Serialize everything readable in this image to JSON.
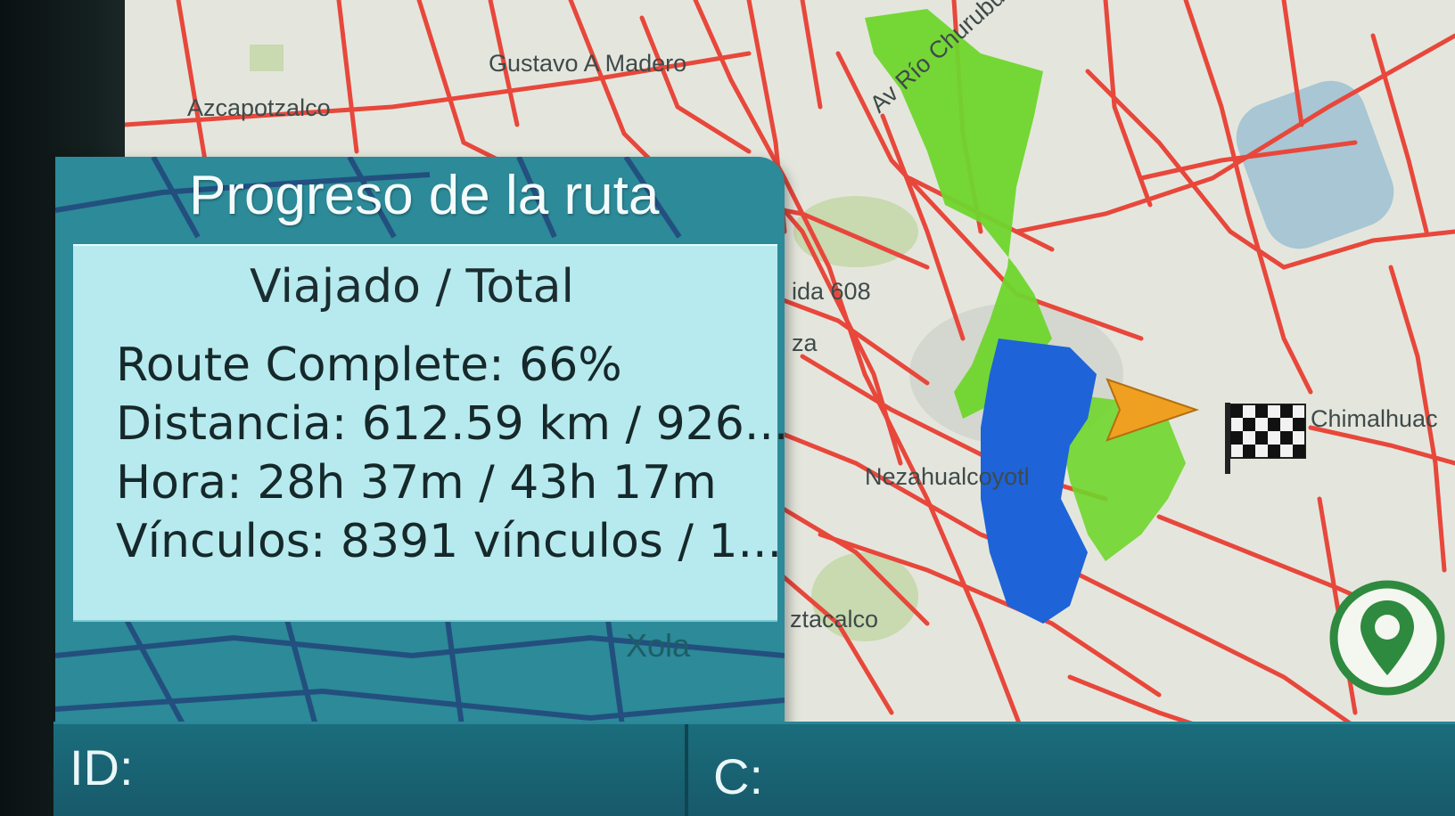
{
  "map": {
    "labels": {
      "azcapotzalco": "Azcapotzalco",
      "gustavo_madero": "Gustavo A Madero",
      "rio_churubusco": "Av Río Churubusco",
      "avenida_608": "ida 608",
      "za": "za",
      "nezahualcoyotl": "Nezahualcoyotl",
      "chimalhuacan": "Chimalhuac",
      "iztacalco": "ztacalco",
      "xola": "Xola"
    },
    "colors": {
      "background": "#e4e6dd",
      "roads": "#e8473b",
      "traveled_route": "#6fd62c",
      "pending_route": "#1e63d8",
      "park": "#c9d9b0",
      "water": "#a8c6d3",
      "vehicle_marker": "#f0a020"
    },
    "icons": {
      "vehicle": "vehicle-arrow-icon",
      "destination": "finish-flag-icon",
      "location_button": "location-pin-icon"
    }
  },
  "panel": {
    "title": "Progreso de la ruta",
    "subtitle": "Viajado / Total",
    "route_complete": "Route Complete: 66%",
    "route_complete_value": 66,
    "distance": "Distancia: 612.59 km / 926...",
    "time": "Hora: 28h 37m / 43h 17m",
    "links": "Vínculos: 8391 vínculos / 1...",
    "colors": {
      "header": "#2c8a99",
      "body": "#b6eaee"
    }
  },
  "statusbar": {
    "id_label": "ID:",
    "c_label": "C:"
  }
}
